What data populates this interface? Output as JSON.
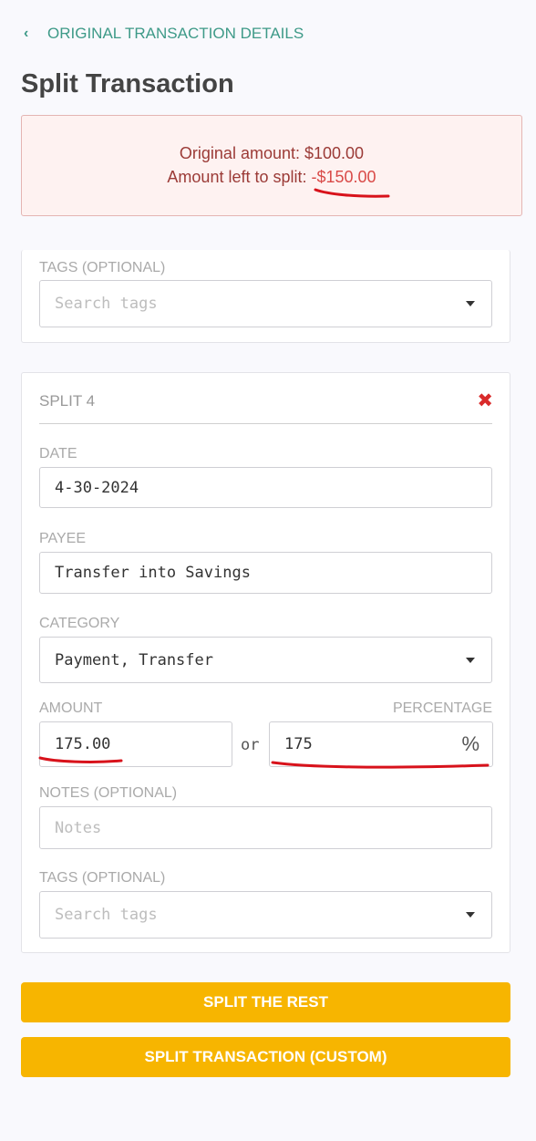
{
  "nav": {
    "back_label": "ORIGINAL TRANSACTION DETAILS"
  },
  "page": {
    "title": "Split Transaction"
  },
  "summary": {
    "original_label": "Original amount: $100.00",
    "left_label": "Amount left to split: ",
    "left_value": "-$150.00"
  },
  "prev_split": {
    "tags_label": "TAGS (OPTIONAL)",
    "tags_placeholder": "Search tags"
  },
  "split": {
    "title": "SPLIT 4",
    "date_label": "DATE",
    "date_value": "4-30-2024",
    "payee_label": "PAYEE",
    "payee_value": "Transfer into Savings",
    "category_label": "CATEGORY",
    "category_value": "Payment, Transfer",
    "amount_label": "AMOUNT",
    "percentage_label": "PERCENTAGE",
    "amount_value": "175.00",
    "or_label": "or",
    "percentage_value": "175",
    "percent_sign": "%",
    "notes_label": "NOTES (OPTIONAL)",
    "notes_placeholder": "Notes",
    "tags_label": "TAGS (OPTIONAL)",
    "tags_placeholder": "Search tags"
  },
  "actions": {
    "split_rest": "SPLIT THE REST",
    "split_custom": "SPLIT TRANSACTION (CUSTOM)"
  },
  "colors": {
    "accent": "#3e9a88",
    "button": "#f7b500",
    "alert_bg": "#fef2f1",
    "annotation": "#d8121b"
  }
}
